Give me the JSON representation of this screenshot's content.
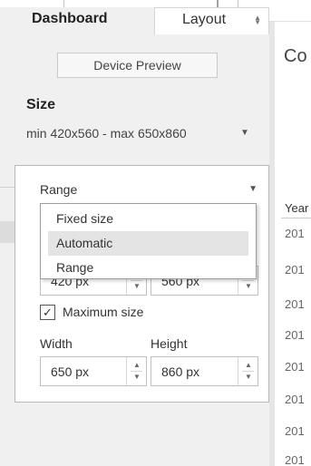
{
  "tabs": {
    "dashboard": "Dashboard",
    "layout": "Layout"
  },
  "device_preview_label": "Device Preview",
  "size_section": {
    "title": "Size",
    "summary": "min 420x560 - max 650x860",
    "range_select": {
      "selected": "Range",
      "options": [
        "Fixed size",
        "Automatic",
        "Range"
      ],
      "highlighted": "Automatic"
    },
    "min": {
      "width": "420 px",
      "height": "560 px"
    },
    "maximum_size": {
      "label": "Maximum size",
      "checked": true
    },
    "width_label": "Width",
    "height_label": "Height",
    "max": {
      "width": "650 px",
      "height": "860 px"
    }
  },
  "canvas": {
    "title": "Co",
    "column_header": "Year",
    "rows": [
      "201",
      "201",
      "201",
      "201",
      "201",
      "201",
      "201",
      "201"
    ]
  },
  "colors": {
    "sidebar_bg": "#f0f0f0",
    "highlight": "#e4e4e4",
    "border": "#b8b8b8"
  }
}
